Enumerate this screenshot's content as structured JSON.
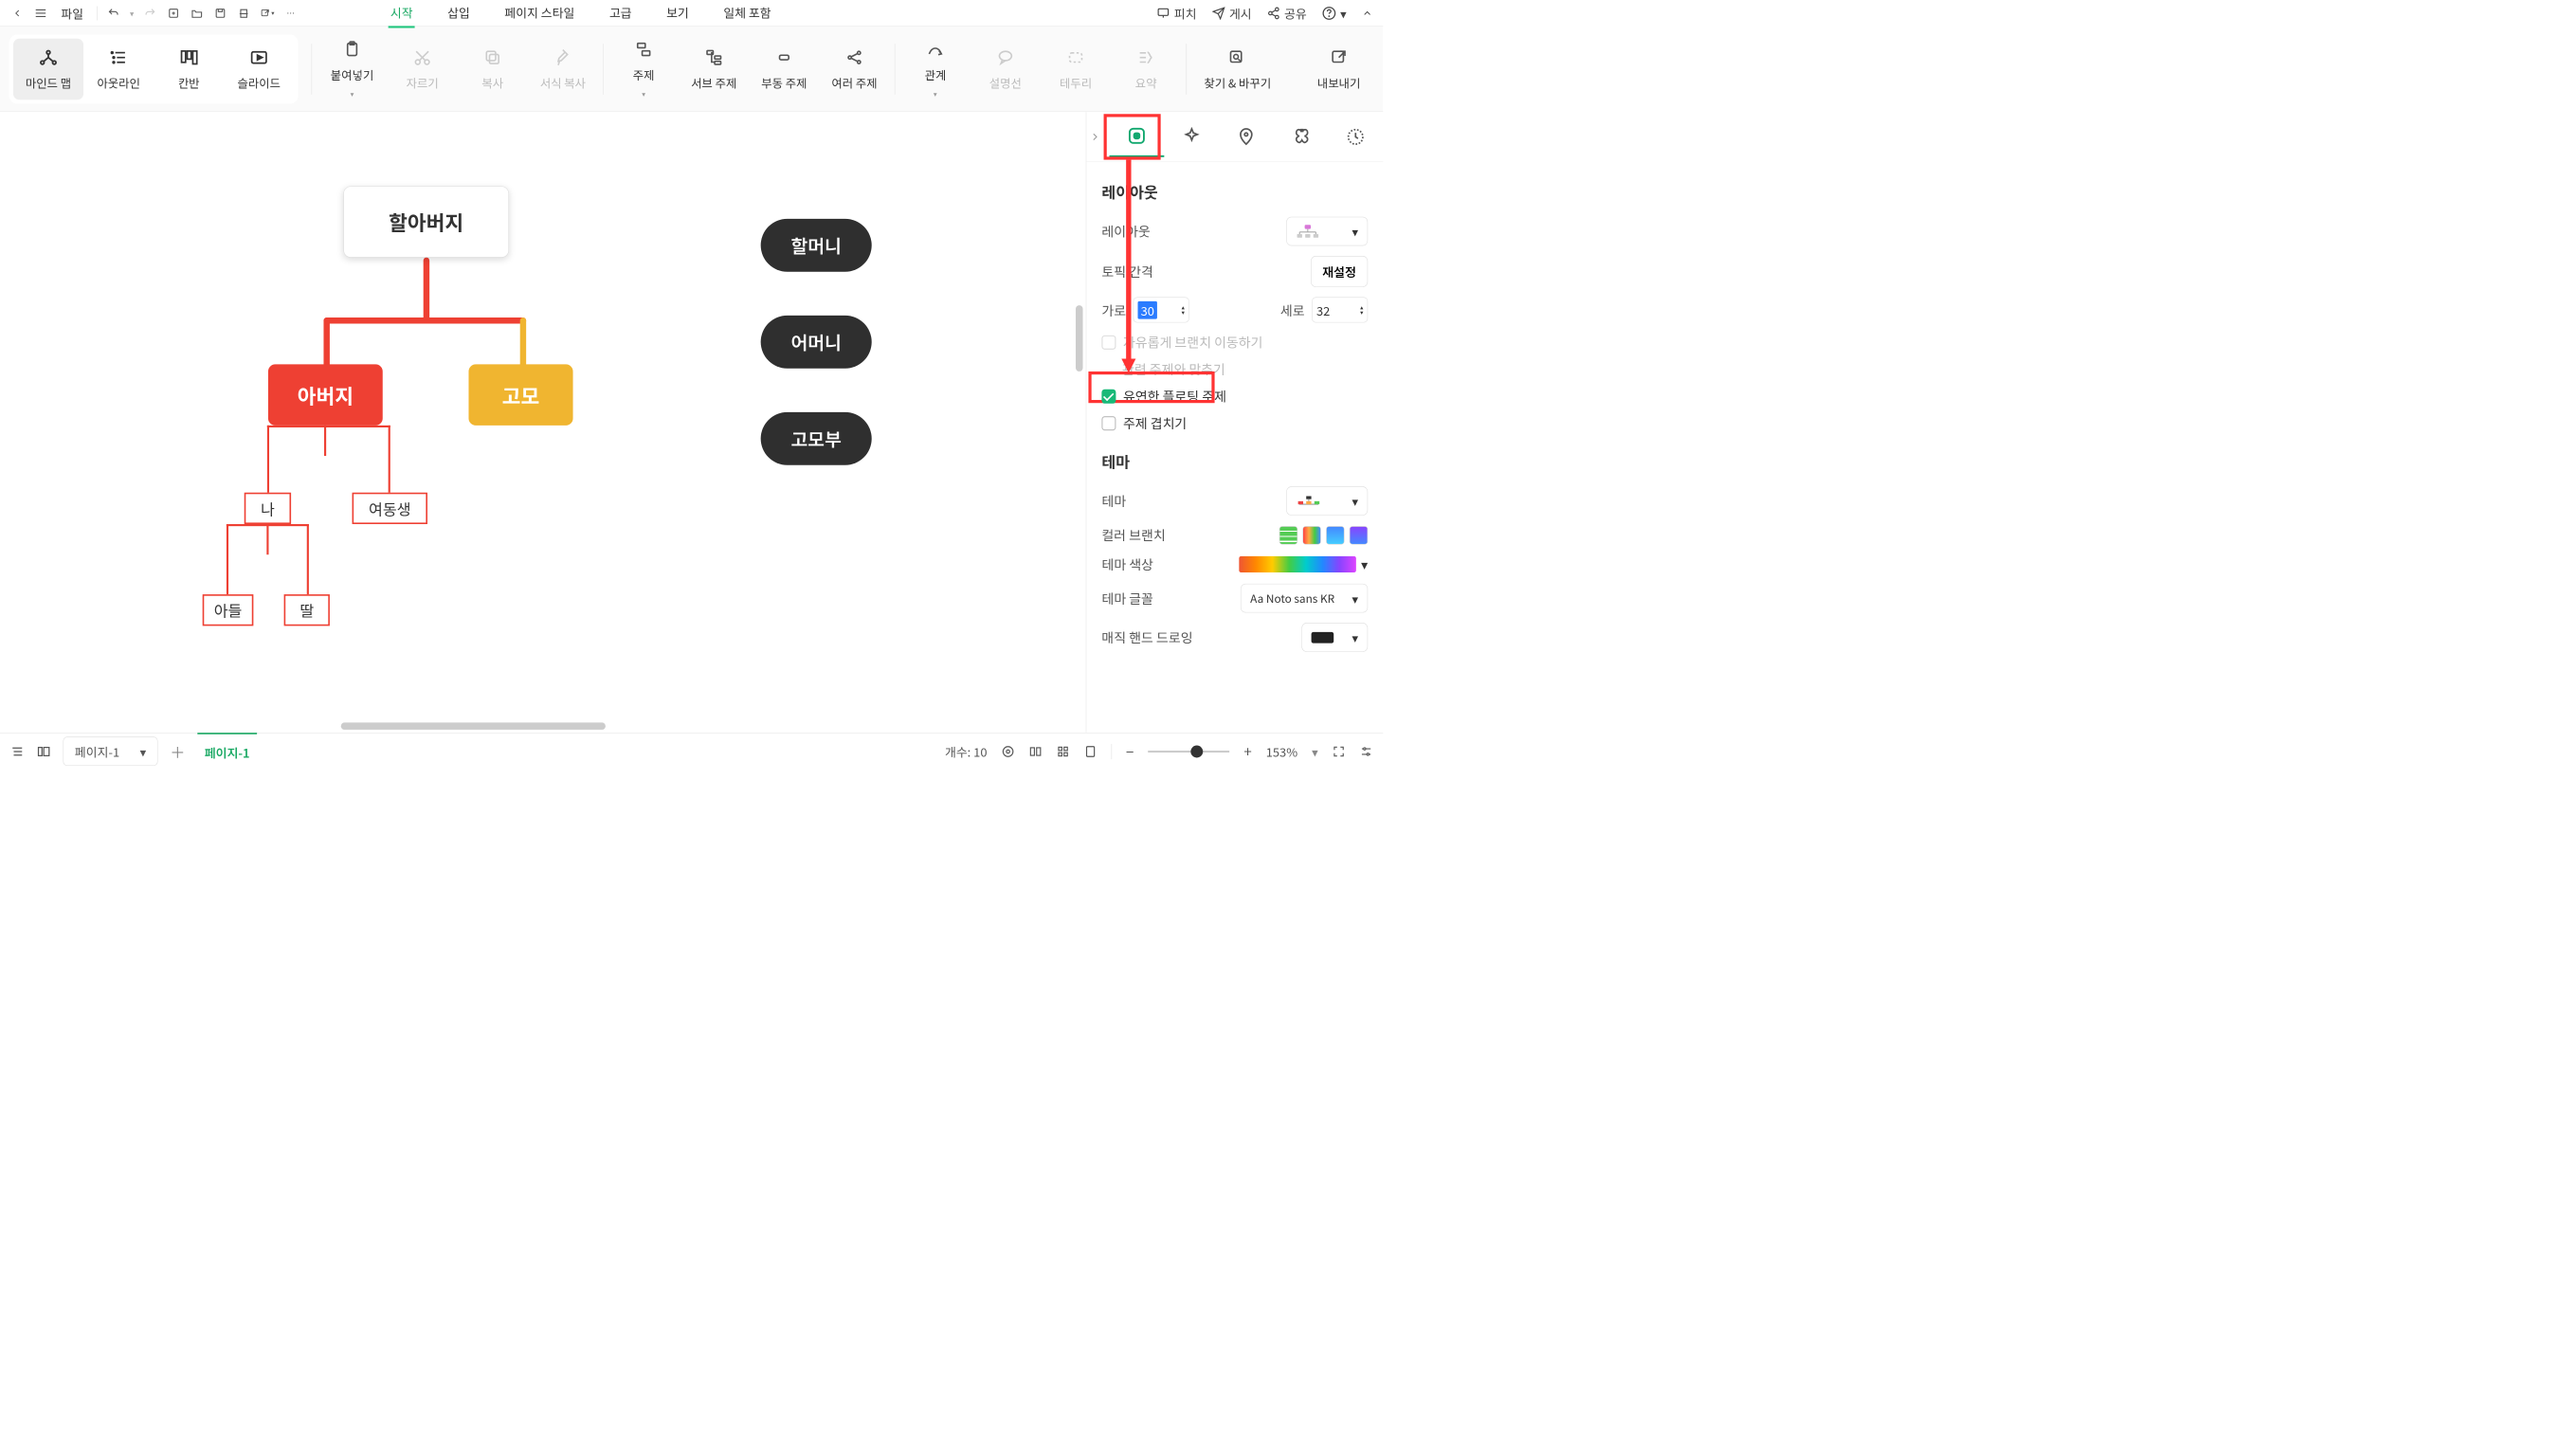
{
  "menu": {
    "file": "파일"
  },
  "tabs": [
    "시작",
    "삽입",
    "페이지 스타일",
    "고급",
    "보기",
    "일체 포함"
  ],
  "active_tab_index": 0,
  "top_right": {
    "pitch": "피치",
    "publish": "게시",
    "share": "공유"
  },
  "ribbon": {
    "views": {
      "mindmap": "마인드 맵",
      "outline": "아웃라인",
      "kanban": "칸반",
      "slide": "슬라이드"
    },
    "clip": {
      "paste": "붙여넣기",
      "cut": "자르기",
      "copy": "복사",
      "format": "서식 복사"
    },
    "topic": {
      "topic": "주제",
      "sub": "서브 주제",
      "float": "부동 주제",
      "multi": "여러 주제"
    },
    "rel": {
      "relation": "관계",
      "callout": "설명선",
      "boundary": "테두리",
      "summary": "요약"
    },
    "tools": {
      "find": "찾기 & 바꾸기",
      "export": "내보내기"
    }
  },
  "map": {
    "root": "할아버지",
    "father": "아버지",
    "aunt": "고모",
    "me": "나",
    "sister": "여동생",
    "son": "아들",
    "daughter": "딸",
    "grandma": "할머니",
    "mother": "어머니",
    "uncle": "고모부"
  },
  "panel": {
    "section_layout": "레이아웃",
    "layout_label": "레이아웃",
    "spacing_label": "토픽 간격",
    "reset": "재설정",
    "h_label": "가로",
    "h_value": "30",
    "v_label": "세로",
    "v_value": "32",
    "free_branch": "자유롭게 브랜치 이동하기",
    "align_related": "관련 주제와 맞추기",
    "flex_float": "유연한 플로팅 주제",
    "overlap": "주제 겹치기",
    "section_theme": "테마",
    "theme_label": "테마",
    "color_branch": "컬러 브랜치",
    "theme_color": "테마 색상",
    "theme_font": "테마 글꼴",
    "font_value": "Noto sans KR",
    "handdrawn": "매직 핸드 드로잉"
  },
  "status": {
    "page_dd": "페이지-1",
    "page_tab": "페이지-1",
    "count_label": "개수:",
    "count": "10",
    "zoom": "153%"
  }
}
